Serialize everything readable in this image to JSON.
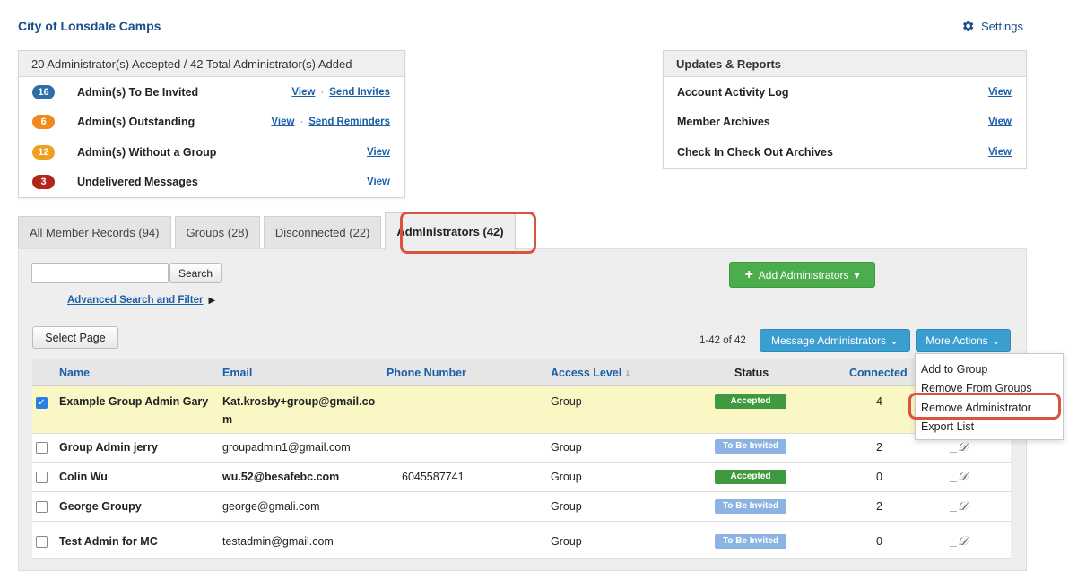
{
  "header": {
    "org_title": "City of Lonsdale Camps",
    "settings_label": "Settings"
  },
  "admin_panel": {
    "title": "20 Administrator(s) Accepted / 42 Total Administrator(s) Added",
    "rows": [
      {
        "count": "16",
        "color": "#2f6fa8",
        "label": "Admin(s) To Be Invited",
        "link1": "View",
        "link2": "Send Invites"
      },
      {
        "count": "6",
        "color": "#f08a1c",
        "label": "Admin(s) Outstanding",
        "link1": "View",
        "link2": "Send Reminders"
      },
      {
        "count": "12",
        "color": "#f0a020",
        "label": "Admin(s) Without a Group",
        "link1": "View"
      },
      {
        "count": "3",
        "color": "#b3261e",
        "label": "Undelivered Messages",
        "link1": "View"
      }
    ]
  },
  "reports_panel": {
    "title": "Updates & Reports",
    "rows": [
      {
        "label": "Account Activity Log",
        "link": "View"
      },
      {
        "label": "Member Archives",
        "link": "View"
      },
      {
        "label": "Check In Check Out Archives",
        "link": "View"
      }
    ]
  },
  "tabs": [
    {
      "label": "All Member Records (94)"
    },
    {
      "label": "Groups (28)"
    },
    {
      "label": "Disconnected (22)"
    },
    {
      "label": "Administrators (42)"
    }
  ],
  "toolbar": {
    "search_button": "Search",
    "advanced_search": "Advanced Search and Filter",
    "add_admins": "Add Administrators",
    "select_page": "Select Page",
    "count_text": "1-42 of 42",
    "message_admins": "Message Administrators",
    "more_actions": "More Actions"
  },
  "table": {
    "columns": {
      "name": "Name",
      "email": "Email",
      "phone": "Phone Number",
      "access": "Access Level",
      "status": "Status",
      "connected": "Connected"
    },
    "rows": [
      {
        "name": "Example Group Admin Gary",
        "email_line1": "Kat.krosby+group@gmail.co",
        "email_line2": "m",
        "phone": "",
        "access": "Group",
        "status": "Accepted",
        "connected": "4"
      },
      {
        "name": "Group Admin jerry",
        "email": "groupadmin1@gmail.com",
        "phone": "",
        "access": "Group",
        "status": "To Be Invited",
        "connected": "2"
      },
      {
        "name": "Colin Wu",
        "email": "wu.52@besafebc.com",
        "phone": "6045587741",
        "access": "Group",
        "status": "Accepted",
        "connected": "0"
      },
      {
        "name": "George Groupy",
        "email": "george@gmali.com",
        "phone": "",
        "access": "Group",
        "status": "To Be Invited",
        "connected": "2"
      },
      {
        "name": "Test Admin for MC",
        "email": "testadmin@gmail.com",
        "phone": "",
        "access": "Group",
        "status": "To Be Invited",
        "connected": "0"
      }
    ]
  },
  "more_actions_menu": {
    "items": [
      {
        "label": "Add to Group"
      },
      {
        "label": "Remove From Groups"
      },
      {
        "label": "Remove Administrator"
      },
      {
        "label": "Export List"
      }
    ]
  },
  "colors": {
    "accent_red": "#d9533f",
    "green": "#4cad4c",
    "blue": "#3a9fd0"
  }
}
